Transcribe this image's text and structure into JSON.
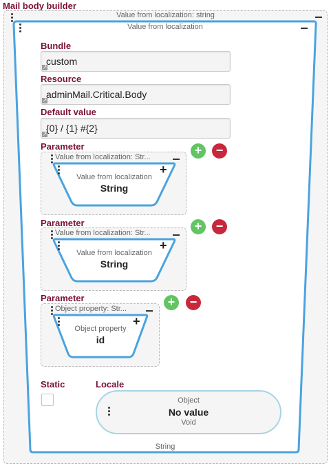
{
  "title": "Mail body builder",
  "outer": {
    "header": "Value from localization: string"
  },
  "main": {
    "header": "Value from localization",
    "footer": "String",
    "bundle": {
      "label": "Bundle",
      "value": "custom"
    },
    "resource": {
      "label": "Resource",
      "value": "adminMail.Critical.Body"
    },
    "default_value": {
      "label": "Default value",
      "value": "{0} / {1} #{2}"
    },
    "parameters": [
      {
        "label": "Parameter",
        "header": "Value from localization: Str...",
        "node_title": "Value from localization",
        "node_type": "String"
      },
      {
        "label": "Parameter",
        "header": "Value from localization: Str...",
        "node_title": "Value from localization",
        "node_type": "String"
      },
      {
        "label": "Parameter",
        "header": "Object property: Str...",
        "node_title": "Object property",
        "node_type": "id"
      }
    ],
    "static": {
      "label": "Static",
      "checked": false
    },
    "locale": {
      "label": "Locale",
      "title": "Object",
      "value": "No value",
      "type": "Void"
    }
  },
  "buttons": {
    "add": "+",
    "remove": "−"
  },
  "colors": {
    "accent_blue": "#4aa3df",
    "label_maroon": "#7a1036",
    "add_green": "#62c462",
    "remove_red": "#c8283b"
  }
}
